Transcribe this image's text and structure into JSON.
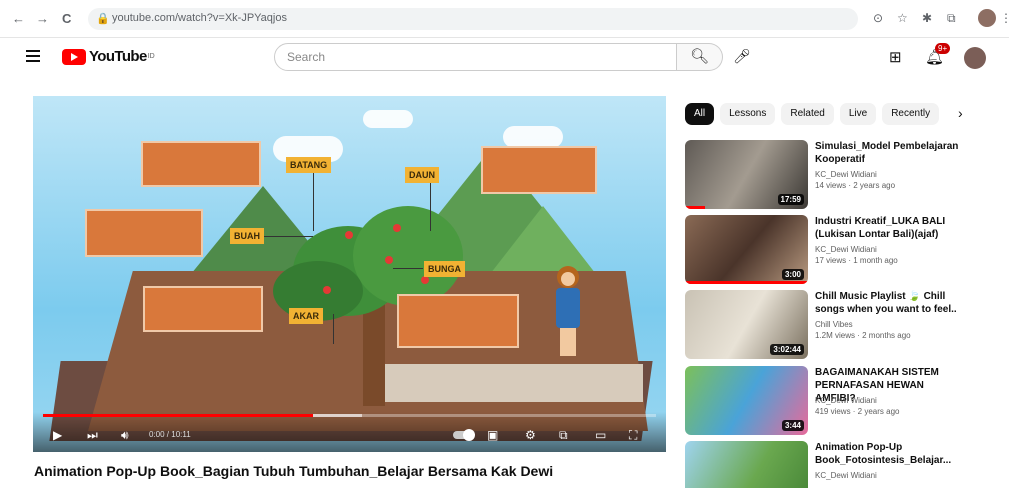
{
  "browser": {
    "url": "youtube.com/watch?v=Xk-JPYaqjos",
    "back": "←",
    "forward": "→",
    "reload": "C"
  },
  "header": {
    "logo_text": "YouTube",
    "logo_region": "ID",
    "search_placeholder": "Search",
    "notifications_count": "9+"
  },
  "player": {
    "labels": {
      "batang": "BATANG",
      "daun": "DAUN",
      "buah": "BUAH",
      "bunga": "BUNGA",
      "akar": "AKAR"
    },
    "time": "0:00 / 10:11",
    "progress_fraction": 0.44,
    "buffered_fraction": 0.52
  },
  "video": {
    "title": "Animation Pop-Up Book_Bagian Tubuh Tumbuhan_Belajar Bersama Kak Dewi"
  },
  "chips": [
    "All",
    "Lessons",
    "Related",
    "Live",
    "Recently"
  ],
  "recommendations": [
    {
      "title": "Simulasi_Model Pembelajaran Kooperatif",
      "channel": "KC_Dewi Widiani",
      "meta": "14 views · 2 years ago",
      "duration": "17:59"
    },
    {
      "title": "Industri Kreatif_LUKA BALI (Lukisan Lontar Bali)(ajaf)",
      "channel": "KC_Dewi Widiani",
      "meta": "17 views · 1 month ago",
      "duration": "3:00"
    },
    {
      "title": "Chill Music Playlist 🍃 Chill songs when you want to feel..",
      "channel": "Chill Vibes",
      "meta": "1.2M views · 2 months ago",
      "duration": "3:02:44"
    },
    {
      "title": "BAGAIMANAKAH SISTEM PERNAFASAN HEWAN AMFIBI?",
      "channel": "KC_Dewi Widiani",
      "meta": "419 views · 2 years ago",
      "duration": "3:44"
    },
    {
      "title": "Animation Pop-Up Book_Fotosintesis_Belajar...",
      "channel": "KC_Dewi Widiani",
      "meta": "",
      "duration": ""
    }
  ]
}
